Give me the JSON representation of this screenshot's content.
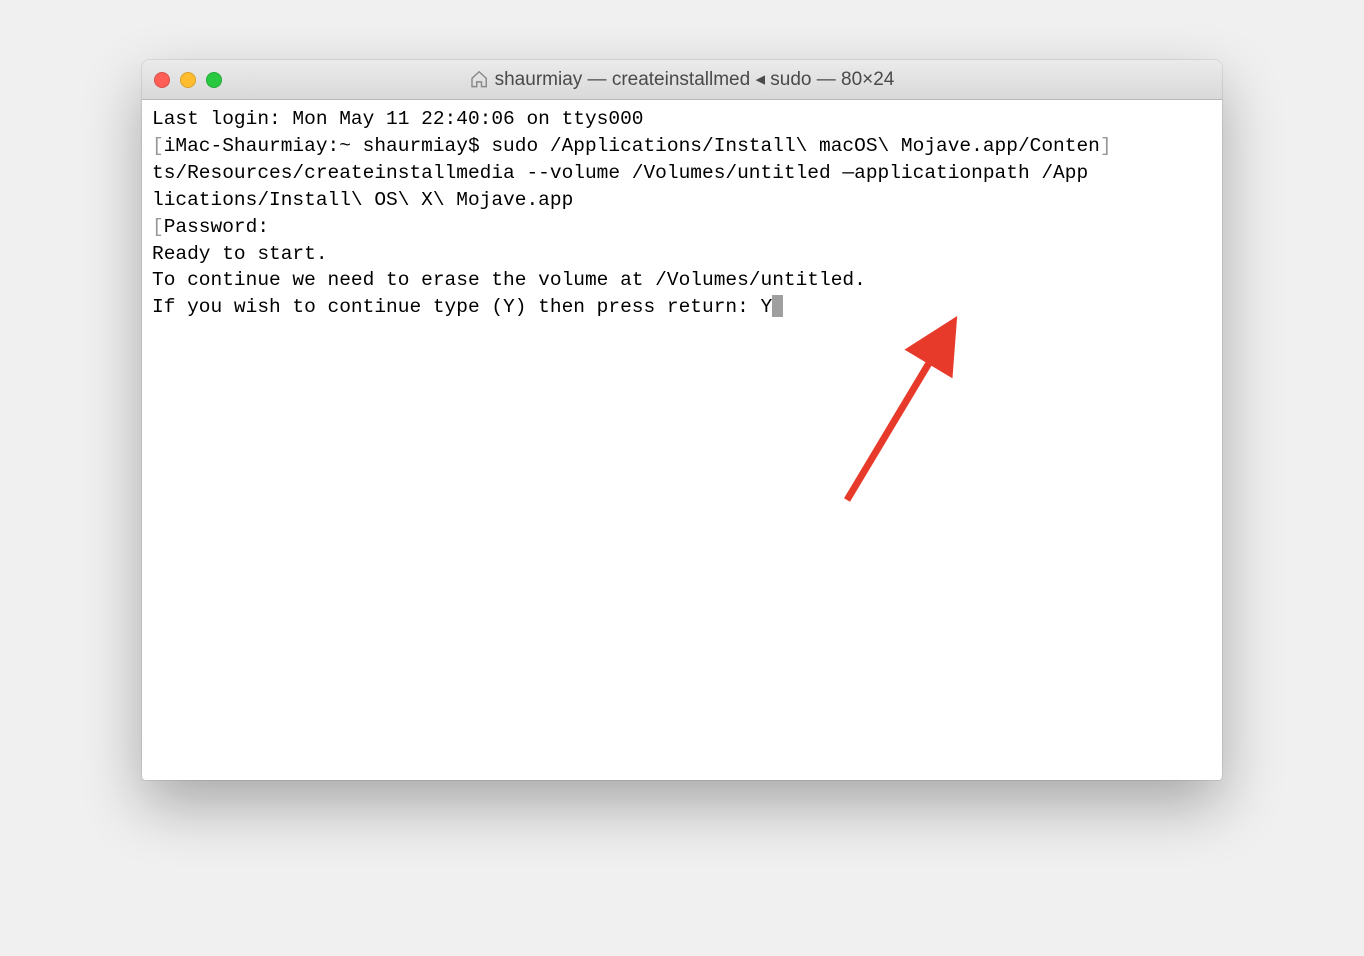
{
  "window": {
    "title": "shaurmiay — createinstallmed ◂ sudo — 80×24"
  },
  "terminal": {
    "line1": "Last login: Mon May 11 22:40:06 on ttys000",
    "line2_prompt_host": "iMac-Shaurmiay:~ shaurmiay$ ",
    "line2_cmd": "sudo /Applications/Install\\ macOS\\ Mojave.app/Conten",
    "line3": "ts/Resources/createinstallmedia --volume /Volumes/untitled —applicationpath /App",
    "line4": "lications/Install\\ OS\\ X\\ Mojave.app",
    "line5": "Password:",
    "line6": "Ready to start.",
    "line7": "To continue we need to erase the volume at /Volumes/untitled.",
    "line8": "If you wish to continue type (Y) then press return: Y"
  },
  "annotation": {
    "arrow_color": "#e83a2b"
  }
}
